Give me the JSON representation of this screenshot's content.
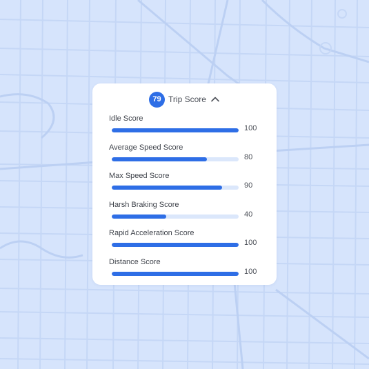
{
  "trip": {
    "overall_score": "79",
    "title": "Trip Score",
    "expanded_icon": "chevron-up-icon"
  },
  "scores": [
    {
      "label": "Idle Score",
      "value": "100",
      "fraction": 1.0
    },
    {
      "label": "Average Speed Score",
      "value": "80",
      "fraction": 0.75
    },
    {
      "label": "Max Speed Score",
      "value": "90",
      "fraction": 0.87
    },
    {
      "label": "Harsh Braking Score",
      "value": "40",
      "fraction": 0.43
    },
    {
      "label": "Rapid Acceleration Score",
      "value": "100",
      "fraction": 1.0
    },
    {
      "label": "Distance Score",
      "value": "100",
      "fraction": 1.0
    }
  ],
  "colors": {
    "accent": "#2e6ee6",
    "track": "#dbe7fb",
    "map_background": "#d6e4fc",
    "map_streets": "#c3d5f5"
  }
}
